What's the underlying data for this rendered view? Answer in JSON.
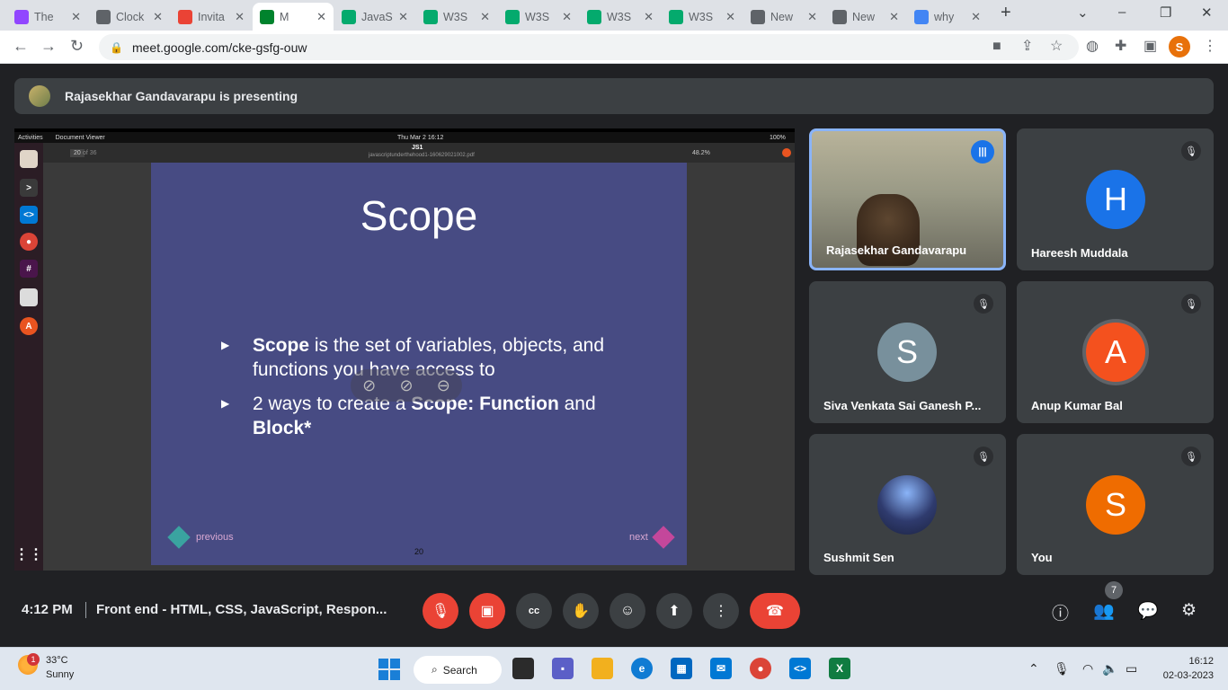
{
  "browser": {
    "tabs": [
      {
        "label": "The",
        "icon": "twitch-icon",
        "color": "#9146ff"
      },
      {
        "label": "Clock",
        "icon": "clock-icon",
        "color": "#5f6368"
      },
      {
        "label": "Invita",
        "icon": "gmail-icon",
        "color": "#ea4335"
      },
      {
        "label": "M",
        "icon": "meet-icon",
        "color": "#00832d"
      },
      {
        "label": "JavaS",
        "icon": "w3schools-icon",
        "color": "#04aa6d"
      },
      {
        "label": "W3S",
        "icon": "w3schools-icon",
        "color": "#04aa6d"
      },
      {
        "label": "W3S",
        "icon": "w3schools-icon",
        "color": "#04aa6d"
      },
      {
        "label": "W3S",
        "icon": "w3schools-icon",
        "color": "#04aa6d"
      },
      {
        "label": "W3S",
        "icon": "w3schools-icon",
        "color": "#04aa6d"
      },
      {
        "label": "New",
        "icon": "chrome-icon",
        "color": "#5f6368"
      },
      {
        "label": "New",
        "icon": "chrome-icon",
        "color": "#5f6368"
      },
      {
        "label": "why",
        "icon": "google-icon",
        "color": "#4285f4"
      }
    ],
    "url": "meet.google.com/cke-gsfg-ouw",
    "profile_initial": "S"
  },
  "meet": {
    "presenting_text": "Rajasekhar Gandavarapu is presenting",
    "slide": {
      "title": "Scope",
      "bullet1_bold": "Scope",
      "bullet1_rest": " is the set of variables, objects, and functions you have access to",
      "bullet2_a": "2 ways to create a ",
      "bullet2_b": "Scope",
      "bullet2_c": ": ",
      "bullet2_d": "Function",
      "bullet2_e": " and ",
      "bullet2_f": "Block*",
      "prev": "previous",
      "next": "next",
      "page": "20"
    },
    "shared_screen": {
      "activities": "Activities",
      "app_menu": "Document Viewer",
      "clock": "Thu Mar 2  16:12",
      "doc_title": "JS1",
      "doc_file": "javascriptunderthehood1-160629021002.pdf",
      "page_field": "20",
      "page_of": "of 36",
      "zoom": "48.2%",
      "battery": "100%"
    },
    "participants": [
      {
        "name": "Rajasekhar Gandavarapu",
        "initial": "",
        "color": ""
      },
      {
        "name": "Hareesh Muddala",
        "initial": "H",
        "color": "#1a73e8"
      },
      {
        "name": "Siva Venkata Sai Ganesh P...",
        "initial": "S",
        "color": "#78909c"
      },
      {
        "name": "Anup Kumar Bal",
        "initial": "A",
        "color": "#f4511e"
      },
      {
        "name": "Sushmit Sen",
        "initial": "",
        "color": "#2f3b6e"
      },
      {
        "name": "You",
        "initial": "S",
        "color": "#ef6c00"
      }
    ],
    "time": "4:12 PM",
    "meeting_name": "Front end - HTML, CSS, JavaScript, Respon...",
    "participant_count": "7"
  },
  "taskbar": {
    "weather_badge": "1",
    "temperature": "33°C",
    "condition": "Sunny",
    "search_label": "Search",
    "time": "16:12",
    "date": "02-03-2023"
  }
}
